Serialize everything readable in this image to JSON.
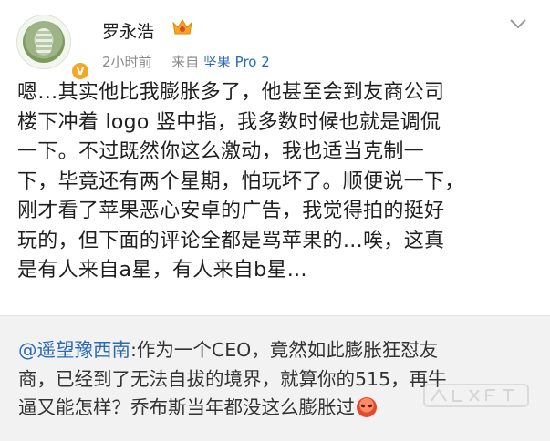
{
  "header": {
    "username": "罗永浩",
    "time": "2小时前",
    "source_prefix": "来自",
    "source": "坚果 Pro 2",
    "vip_icon": "crown-vip-icon",
    "verified_icon": "verified-v-icon",
    "menu_icon": "chevron-down-icon"
  },
  "post": {
    "lines": [
      "嗯…其实他比我膨胀多了，他甚至会到友商公司",
      "楼下冲着 logo 竖中指，我多数时候也就是调侃",
      "一下。不过既然你这么激动，我也适当克制一",
      "下，毕竟还有两个星期，怕玩坏了。顺便说一下，",
      "刚才看了苹果恶心安卓的广告，我觉得拍的挺好",
      "玩的，但下面的评论全都是骂苹果的…唉，这真",
      "是有人来自a星，有人来自b星…"
    ]
  },
  "repost": {
    "mention": "@遥望豫西南",
    "line1_rest": ":作为一个CEO，竟然如此膨胀狂怼友",
    "line2": "商，已经到了无法自拔的境界，就算你的515，再牛",
    "line3": "逼又能怎样？乔布斯当年都没这么膨胀过",
    "emoji": "angry-face-emoji"
  },
  "colors": {
    "link": "#2a69b8",
    "repost_bg": "#f2f2f2",
    "badge": "#f5a623"
  }
}
